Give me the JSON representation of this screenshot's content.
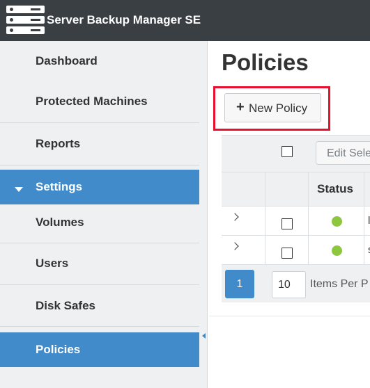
{
  "app": {
    "title": "Server Backup Manager SE",
    "logo_icon": "server-rack-icon"
  },
  "sidebar": {
    "items": [
      {
        "label": "Dashboard"
      },
      {
        "label": "Protected Machines"
      },
      {
        "label": "Reports"
      },
      {
        "label": "Settings",
        "expanded": true
      },
      {
        "label": "Volumes"
      },
      {
        "label": "Users"
      },
      {
        "label": "Disk Safes"
      },
      {
        "label": "Policies",
        "selected": true
      }
    ]
  },
  "page": {
    "title": "Policies"
  },
  "toolbar": {
    "new_policy_label": "New Policy",
    "new_policy_icon": "+"
  },
  "grid": {
    "edit_selected_label": "Edit Sele",
    "columns": {
      "status": "Status"
    },
    "rows": [
      {
        "status": "active",
        "name": "l"
      },
      {
        "status": "active",
        "name": "s"
      }
    ],
    "pager": {
      "current_page": "1",
      "items_per_page": "10",
      "items_per_page_label": "Items Per P"
    }
  },
  "colors": {
    "header_bg": "#3a3f44",
    "accent": "#428bca",
    "status_ok": "#8dc63f",
    "highlight": "#e8112d"
  }
}
